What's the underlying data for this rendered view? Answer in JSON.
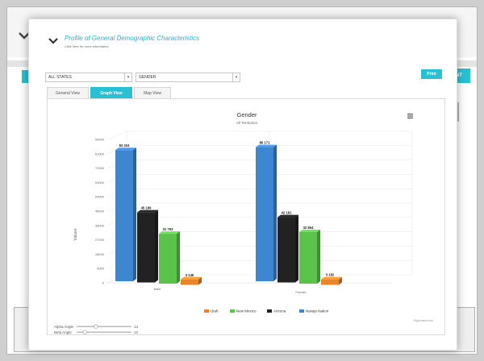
{
  "background_page": {
    "print_label": "PRINT"
  },
  "modal": {
    "title": "Profile of General Demographic Characteristics",
    "subtitle": "Click here for more information",
    "state_select": "ALL STATES",
    "topic_select": "GENDER",
    "print_label": "Print",
    "tabs": [
      {
        "label": "General View",
        "active": false
      },
      {
        "label": "Graph View",
        "active": true
      },
      {
        "label": "Map View",
        "active": false
      }
    ],
    "controls": {
      "alpha_label": "Alpha Angle",
      "alpha_value": "14",
      "beta_label": "Beta Angle",
      "beta_value": "12",
      "alpha_level": 0.35,
      "beta_level": 0.15
    },
    "credit": "Highcharts.com",
    "menu_icon": "hamburger-icon"
  },
  "colors": {
    "accent": "#2ac0d4",
    "utah": "#e8852c",
    "new_mexico": "#5bc24b",
    "arizona": "#222222",
    "navajo_nation": "#3f86d0"
  },
  "chart_data": {
    "type": "bar",
    "title": "Gender",
    "subtitle": "All Territories",
    "ylabel": "Values",
    "xlabel": "",
    "ylim": [
      0,
      90000
    ],
    "y_ticks": [
      "0",
      "9000",
      "18000",
      "27000",
      "36000",
      "45000",
      "54000",
      "63000",
      "72000",
      "81000",
      "90000"
    ],
    "categories": [
      "Male",
      "Female"
    ],
    "series": [
      {
        "name": "Navajo Nation",
        "color": "#3f86d0",
        "values": [
          84324,
          86171
        ],
        "labels": [
          "84 324",
          "86 171"
        ]
      },
      {
        "name": "Arizona",
        "color": "#222222",
        "values": [
          45186,
          42181
        ],
        "labels": [
          "45 186",
          "42 181"
        ]
      },
      {
        "name": "New Mexico",
        "color": "#5bc24b",
        "values": [
          31793,
          32854
        ],
        "labels": [
          "31 793",
          "32 854"
        ]
      },
      {
        "name": "Utah",
        "color": "#e8852c",
        "values": [
          3145,
          3182
        ],
        "labels": [
          "3 145",
          "3 182"
        ]
      }
    ],
    "legend_order": [
      "Utah",
      "New Mexico",
      "Arizona",
      "Navajo Nation"
    ],
    "legend_position": "bottom-center",
    "grid": true,
    "depth_3d": true
  }
}
